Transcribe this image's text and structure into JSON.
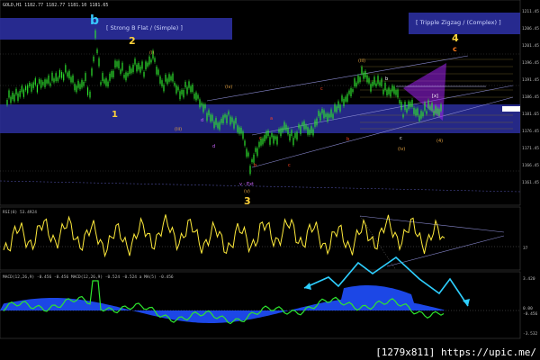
{
  "header": {
    "symbol_line": "GOLD,H1  1182.77 1182.77 1181.10 1181.65"
  },
  "main_panel": {
    "box_left_label": "[ Strong B Flat / (Simple) ]",
    "box_right_label": "[ Tripple Zigzag / (Complex) ]",
    "waves": {
      "b": "b",
      "w2": "2",
      "w1": "1",
      "w3": "3",
      "w4": "4",
      "c": "c",
      "v_ext": "v - Ext",
      "iii": "(iii)",
      "iv": "(iv)",
      "v": "(v)",
      "four": "(4)"
    },
    "price_axis": [
      "1211.45",
      "1206.45",
      "1201.45",
      "1196.45",
      "1191.45",
      "1186.45",
      "1181.65",
      "1176.45",
      "1171.45",
      "1166.45",
      "1161.45"
    ]
  },
  "rsi_panel": {
    "label": "RSI(8) 53.4924",
    "axis": [
      "37"
    ]
  },
  "macd_panel": {
    "label": "MACD(12,26,9) -0.456  -0.456  MACD(12,26,9) -0.524  -0.524  a MA(5) -0.456",
    "axis": [
      "3.420",
      "0.00",
      "-0.456",
      "-3.532"
    ]
  },
  "footer": {
    "watermark": "[1279x811] https://upic.me/"
  },
  "colors": {
    "background": "#000000",
    "blue_band": "#2b2f9e",
    "candle_green": "#2ee62e",
    "rsi_line": "#ffeb3b",
    "macd_line": "#2ee62e",
    "macd_hist": "#1f4fff",
    "arrow": "#2ecfff",
    "triangle": "#a020f0"
  }
}
